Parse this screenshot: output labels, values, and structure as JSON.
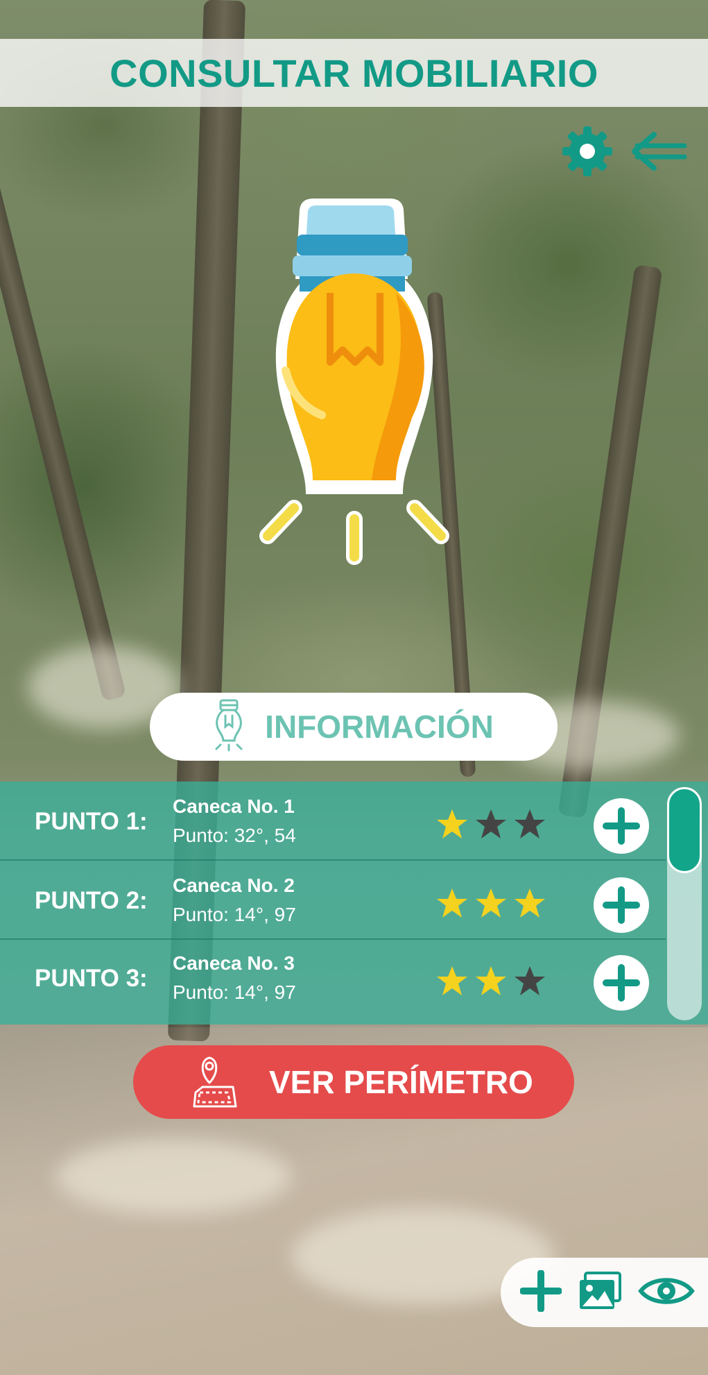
{
  "header": {
    "title": "CONSULTAR MOBILIARIO"
  },
  "top_icons": [
    {
      "name": "gear-icon",
      "label": "Configuración"
    },
    {
      "name": "arrow-left-icon",
      "label": "Volver"
    }
  ],
  "main_icon": "light-bulb-icon",
  "info_button": {
    "label": "INFORMACIÓN",
    "icon": "light-bulb-outline-icon"
  },
  "points": [
    {
      "punto": "PUNTO 1:",
      "name": "Caneca No. 1",
      "coords": "Punto: 32°, 54",
      "rating": 1,
      "max_rating": 3
    },
    {
      "punto": "PUNTO 2:",
      "name": "Caneca No. 2",
      "coords": "Punto: 14°, 97",
      "rating": 3,
      "max_rating": 3
    },
    {
      "punto": "PUNTO 3:",
      "name": "Caneca No. 3",
      "coords": "Punto: 14°, 97",
      "rating": 2,
      "max_rating": 3
    }
  ],
  "perimeter_button": {
    "label": "VER PERÍMETRO",
    "icon": "map-pin-icon"
  },
  "bottom_bar": [
    {
      "name": "plus-icon"
    },
    {
      "name": "gallery-icon"
    },
    {
      "name": "eye-icon"
    }
  ],
  "colors": {
    "accent": "#129a86",
    "list_bg": "#3ab098",
    "star_on": "#f5d21e",
    "star_off": "#444444",
    "perimeter": "#e54b4b"
  }
}
